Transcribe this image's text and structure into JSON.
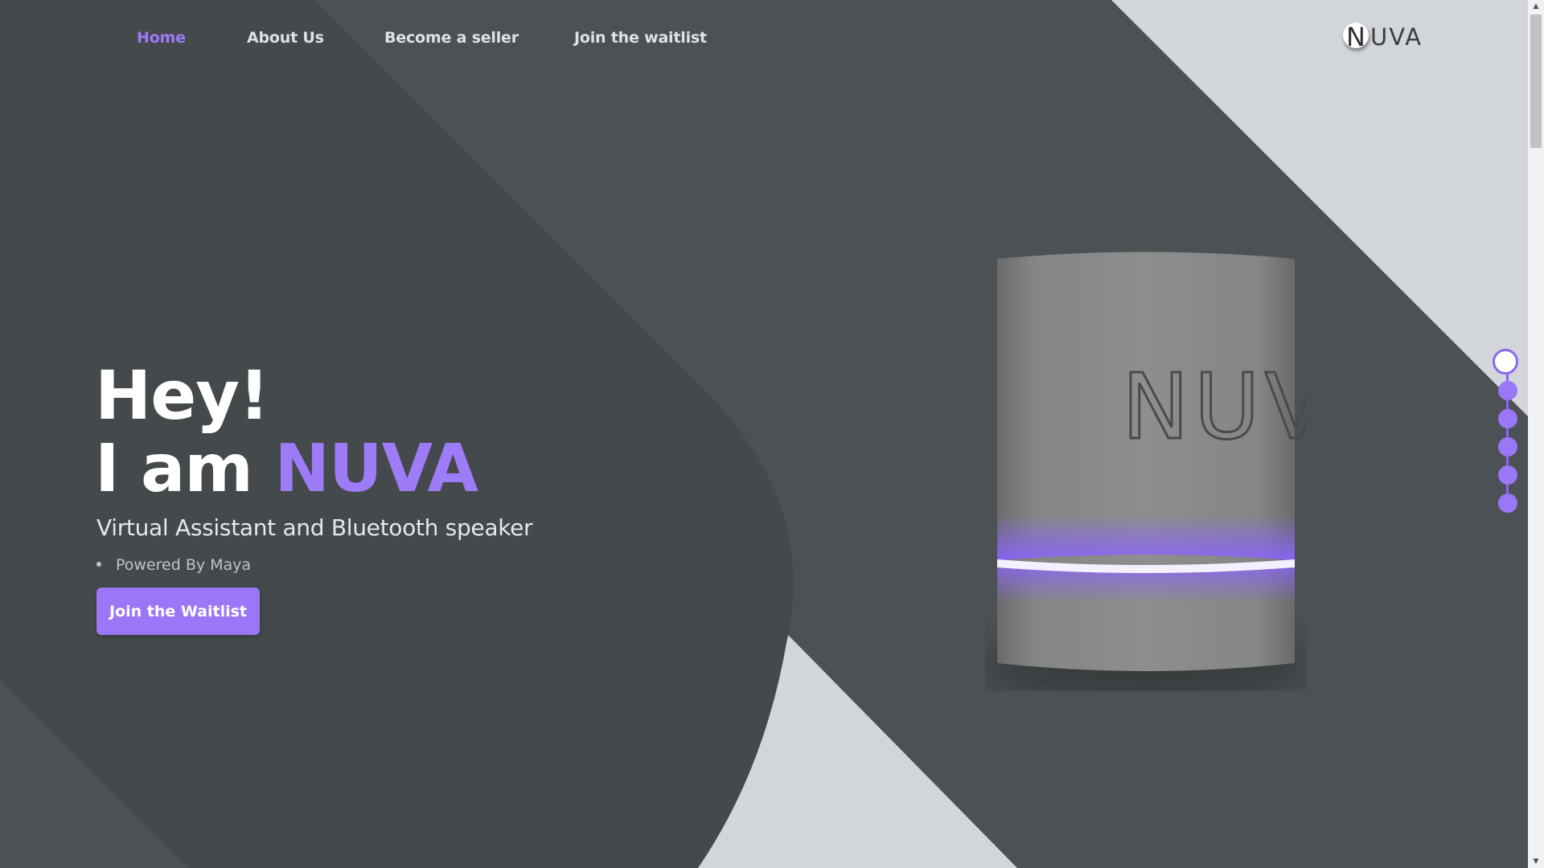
{
  "nav": {
    "items": [
      {
        "label": "Home",
        "active": true
      },
      {
        "label": "About Us",
        "active": false
      },
      {
        "label": "Become a seller",
        "active": false
      },
      {
        "label": "Join the waitlist",
        "active": false
      }
    ]
  },
  "logo": {
    "mark": "N",
    "text": "UVA"
  },
  "hero": {
    "line1": "Hey!",
    "line2_prefix": "I am ",
    "line2_brand": "NUVA",
    "subtitle": "Virtual Assistant and Bluetooth speaker",
    "bullet": "Powered By Maya",
    "cta_label": "Join the Waitlist"
  },
  "product": {
    "engraving": "NUVA",
    "light_color": "#8a63ff"
  },
  "pager": {
    "count": 6,
    "active_index": 0
  },
  "scrollbar": {
    "up_icon": "triangle-up-icon",
    "down_icon": "triangle-down-icon",
    "up_glyph": "▲",
    "down_glyph": "▼"
  },
  "colors": {
    "accent": "#9b76f6",
    "background_dark": "#4b5154",
    "background_light": "#d2d5d9"
  }
}
